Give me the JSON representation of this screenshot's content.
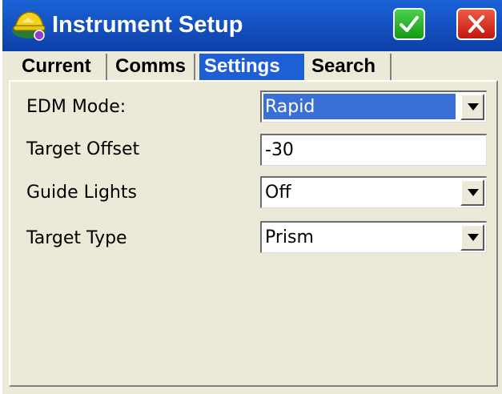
{
  "window": {
    "title": "Instrument Setup",
    "ok_icon": "checkmark-icon",
    "close_icon": "close-icon",
    "colors": {
      "titlebar": "#1b63d7",
      "ok": "#2fb52f",
      "close": "#e03a28",
      "selected": "#3a6fd8"
    }
  },
  "tabs": [
    {
      "label": "Current",
      "active": false
    },
    {
      "label": "Comms",
      "active": false
    },
    {
      "label": "Settings",
      "active": true
    },
    {
      "label": "Search",
      "active": false
    }
  ],
  "form": {
    "edm_mode": {
      "label": "EDM Mode:",
      "value": "Rapid"
    },
    "target_offset": {
      "label": "Target Offset",
      "value": "-30"
    },
    "guide_lights": {
      "label": "Guide Lights",
      "value": "Off"
    },
    "target_type": {
      "label": "Target Type",
      "value": "Prism"
    }
  }
}
